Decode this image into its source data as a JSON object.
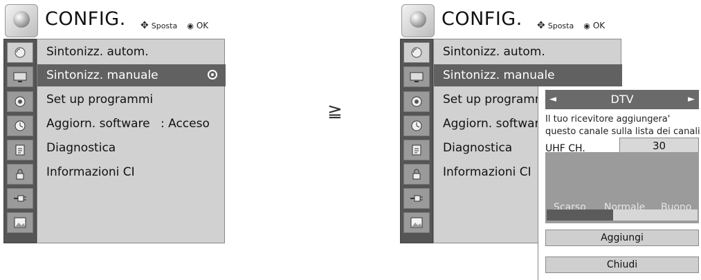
{
  "menu": {
    "title": "CONFIG.",
    "hint_move_label": "Sposta",
    "hint_ok_label": "OK"
  },
  "left_panel": {
    "items": [
      {
        "label": "Sintonizz. autom.",
        "value": ""
      },
      {
        "label": "Sintonizz. manuale",
        "value": ""
      },
      {
        "label": "Set up programmi",
        "value": ""
      },
      {
        "label": "Aggiorn. software",
        "value": ": Acceso"
      },
      {
        "label": "Diagnostica",
        "value": ""
      },
      {
        "label": "Informazioni CI",
        "value": ""
      }
    ],
    "selected_index": 1
  },
  "right_panel": {
    "items": [
      {
        "label": "Sintonizz. autom."
      },
      {
        "label": "Sintonizz. manuale"
      },
      {
        "label": "Set up programmi"
      },
      {
        "label": "Aggiorn. software"
      },
      {
        "label": "Diagnostica"
      },
      {
        "label": "Informazioni CI"
      }
    ],
    "selected_index": 1
  },
  "separator": "≧",
  "side_icons": [
    "satellite-dish-icon",
    "tv-screen-icon",
    "speaker-icon",
    "clock-icon",
    "lock-document-icon",
    "padlock-icon",
    "plug-icon",
    "photo-icon"
  ],
  "popup": {
    "mode_prev_glyph": "◄",
    "mode": "DTV",
    "mode_next_glyph": "►",
    "message": "Il tuo ricevitore aggiungera' questo canale sulla lista dei canali",
    "channel_label": "UHF CH.",
    "channel_value": "30",
    "signal_labels": [
      "Scarso",
      "Normale",
      "Buono"
    ],
    "signal_level": 0.44,
    "add_button": "Aggiungi",
    "close_button": "Chiudi"
  },
  "colors": {
    "item_area": "#d1d1d1",
    "selected_row": "#616161",
    "icon_column": "#555555",
    "signal_panel": "#9b9b9b",
    "popup_header": "#6a6a6a"
  }
}
